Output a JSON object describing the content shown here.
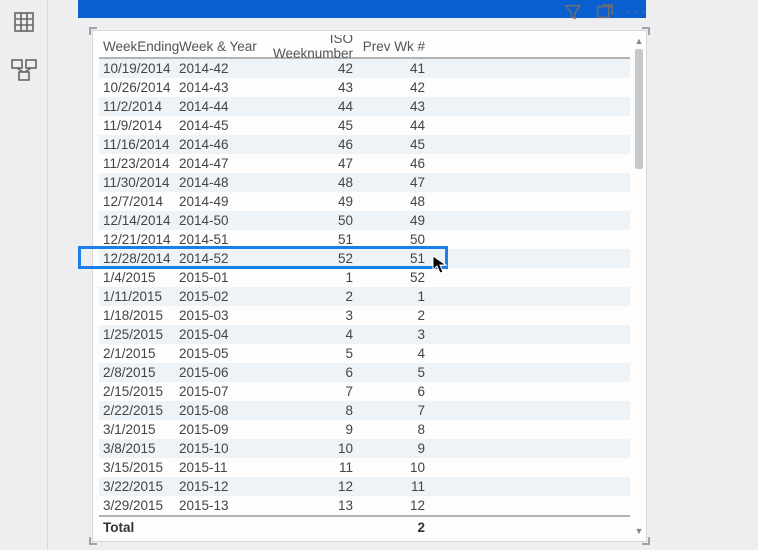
{
  "columns": {
    "week_ending": "WeekEnding",
    "week_year": "Week & Year",
    "iso_week": "ISO Weeknumber",
    "prev_wk": "Prev Wk #"
  },
  "rows": [
    {
      "d": "10/19/2014",
      "wy": "2014-42",
      "iso": "42",
      "pw": "41"
    },
    {
      "d": "10/26/2014",
      "wy": "2014-43",
      "iso": "43",
      "pw": "42"
    },
    {
      "d": "11/2/2014",
      "wy": "2014-44",
      "iso": "44",
      "pw": "43"
    },
    {
      "d": "11/9/2014",
      "wy": "2014-45",
      "iso": "45",
      "pw": "44"
    },
    {
      "d": "11/16/2014",
      "wy": "2014-46",
      "iso": "46",
      "pw": "45"
    },
    {
      "d": "11/23/2014",
      "wy": "2014-47",
      "iso": "47",
      "pw": "46"
    },
    {
      "d": "11/30/2014",
      "wy": "2014-48",
      "iso": "48",
      "pw": "47"
    },
    {
      "d": "12/7/2014",
      "wy": "2014-49",
      "iso": "49",
      "pw": "48"
    },
    {
      "d": "12/14/2014",
      "wy": "2014-50",
      "iso": "50",
      "pw": "49"
    },
    {
      "d": "12/21/2014",
      "wy": "2014-51",
      "iso": "51",
      "pw": "50"
    },
    {
      "d": "12/28/2014",
      "wy": "2014-52",
      "iso": "52",
      "pw": "51"
    },
    {
      "d": "1/4/2015",
      "wy": "2015-01",
      "iso": "1",
      "pw": "52"
    },
    {
      "d": "1/11/2015",
      "wy": "2015-02",
      "iso": "2",
      "pw": "1"
    },
    {
      "d": "1/18/2015",
      "wy": "2015-03",
      "iso": "3",
      "pw": "2"
    },
    {
      "d": "1/25/2015",
      "wy": "2015-04",
      "iso": "4",
      "pw": "3"
    },
    {
      "d": "2/1/2015",
      "wy": "2015-05",
      "iso": "5",
      "pw": "4"
    },
    {
      "d": "2/8/2015",
      "wy": "2015-06",
      "iso": "6",
      "pw": "5"
    },
    {
      "d": "2/15/2015",
      "wy": "2015-07",
      "iso": "7",
      "pw": "6"
    },
    {
      "d": "2/22/2015",
      "wy": "2015-08",
      "iso": "8",
      "pw": "7"
    },
    {
      "d": "3/1/2015",
      "wy": "2015-09",
      "iso": "9",
      "pw": "8"
    },
    {
      "d": "3/8/2015",
      "wy": "2015-10",
      "iso": "10",
      "pw": "9"
    },
    {
      "d": "3/15/2015",
      "wy": "2015-11",
      "iso": "11",
      "pw": "10"
    },
    {
      "d": "3/22/2015",
      "wy": "2015-12",
      "iso": "12",
      "pw": "11"
    },
    {
      "d": "3/29/2015",
      "wy": "2015-13",
      "iso": "13",
      "pw": "12"
    }
  ],
  "total": {
    "label": "Total",
    "prev_wk": "2"
  },
  "highlight_row_index": 10,
  "chart_data": {
    "type": "table",
    "columns": [
      "WeekEnding",
      "Week & Year",
      "ISO Weeknumber",
      "Prev Wk #"
    ],
    "highlighted_row": {
      "WeekEnding": "12/28/2014",
      "Week & Year": "2014-52",
      "ISO Weeknumber": 52,
      "Prev Wk #": 51
    },
    "total_row": {
      "WeekEnding": "Total",
      "Prev Wk #": 2
    }
  }
}
